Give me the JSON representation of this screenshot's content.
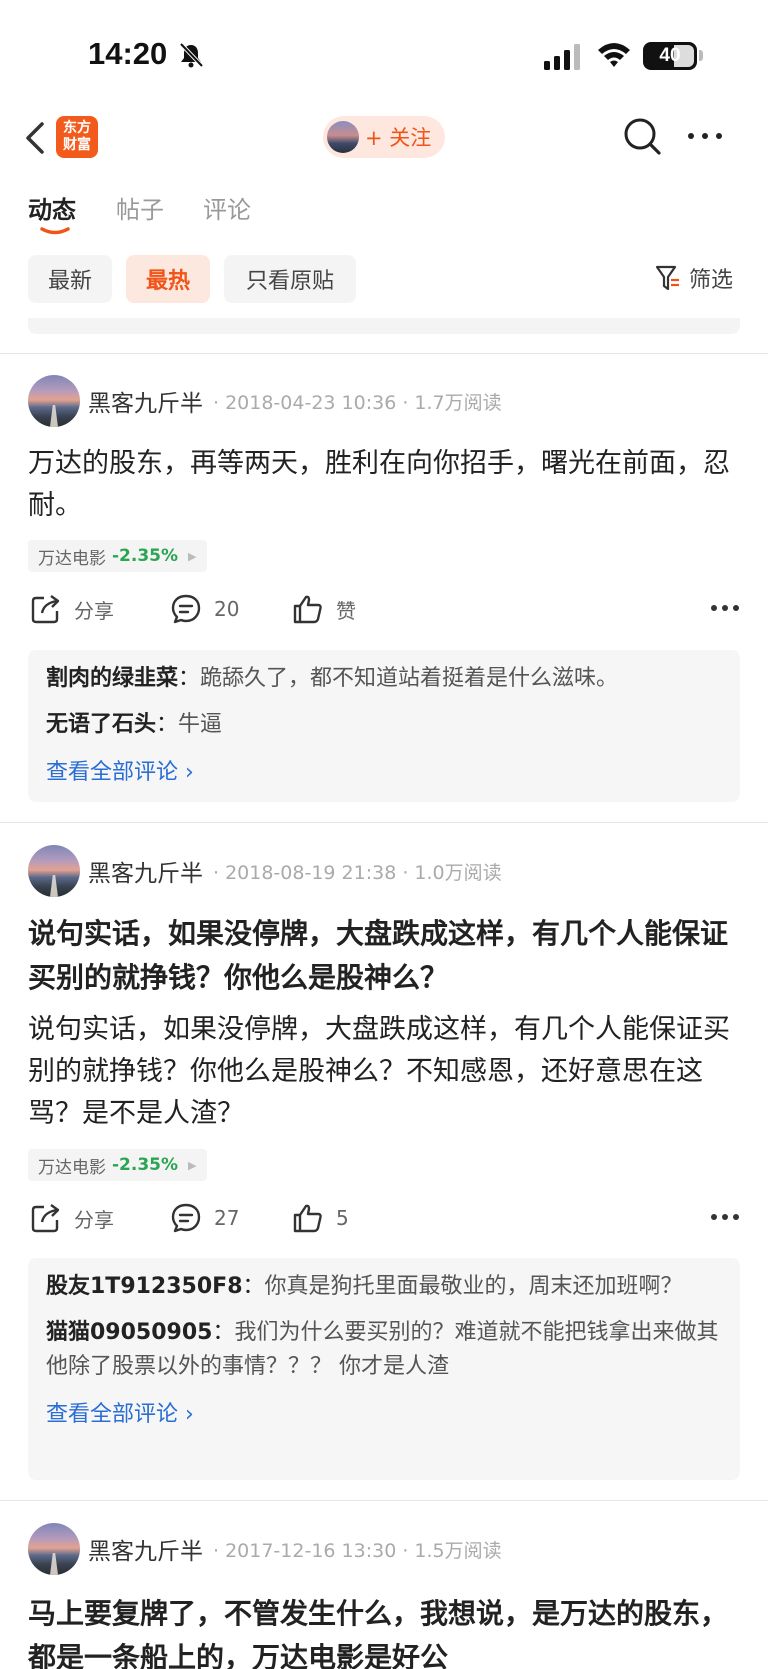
{
  "status_bar": {
    "time": "14:20",
    "battery": "40"
  },
  "nav": {
    "brand_line1": "东方",
    "brand_line2": "财富",
    "follow_label": "+ 关注"
  },
  "tabs": [
    {
      "label": "动态"
    },
    {
      "label": "帖子"
    },
    {
      "label": "评论"
    }
  ],
  "filters": [
    {
      "label": "最新"
    },
    {
      "label": "最热"
    },
    {
      "label": "只看原贴"
    }
  ],
  "filter_btn": "筛选",
  "posts": [
    {
      "author": "黑客九斤半",
      "meta": "· 2018-04-23 10:36 · 1.7万阅读",
      "title": "",
      "body": "万达的股东，再等两天，胜利在向你招手，曙光在前面，忍耐。",
      "stock": {
        "name": "万达电影",
        "change": "-2.35%"
      },
      "share_label": "分享",
      "comment_count": "20",
      "like_label": "赞",
      "comments": [
        {
          "user": "割肉的绿韭菜",
          "text": "跪舔久了，都不知道站着挺着是什么滋味。"
        },
        {
          "user": "无语了石头",
          "text": "牛逼"
        }
      ],
      "view_all": "查看全部评论"
    },
    {
      "author": "黑客九斤半",
      "meta": "· 2018-08-19 21:38 · 1.0万阅读",
      "title": "说句实话，如果没停牌，大盘跌成这样，有几个人能保证买别的就挣钱？你他么是股神么？",
      "body": "说句实话，如果没停牌，大盘跌成这样，有几个人能保证买别的就挣钱？你他么是股神么？不知感恩，还好意思在这骂？是不是人渣？",
      "stock": {
        "name": "万达电影",
        "change": "-2.35%"
      },
      "share_label": "分享",
      "comment_count": "27",
      "like_label": "5",
      "comments": [
        {
          "user": "股友1T912350F8",
          "text": "你真是狗托里面最敬业的，周末还加班啊？"
        },
        {
          "user": "猫猫09050905",
          "text": "我们为什么要买别的？难道就不能把钱拿出来做其他除了股票以外的事情？？？ 你才是人渣"
        }
      ],
      "view_all": "查看全部评论"
    },
    {
      "author": "黑客九斤半",
      "meta": "· 2017-12-16 13:30 · 1.5万阅读",
      "title": "马上要复牌了，不管发生什么，我想说，是万达的股东，都是一条船上的，万达电影是好公"
    }
  ]
}
